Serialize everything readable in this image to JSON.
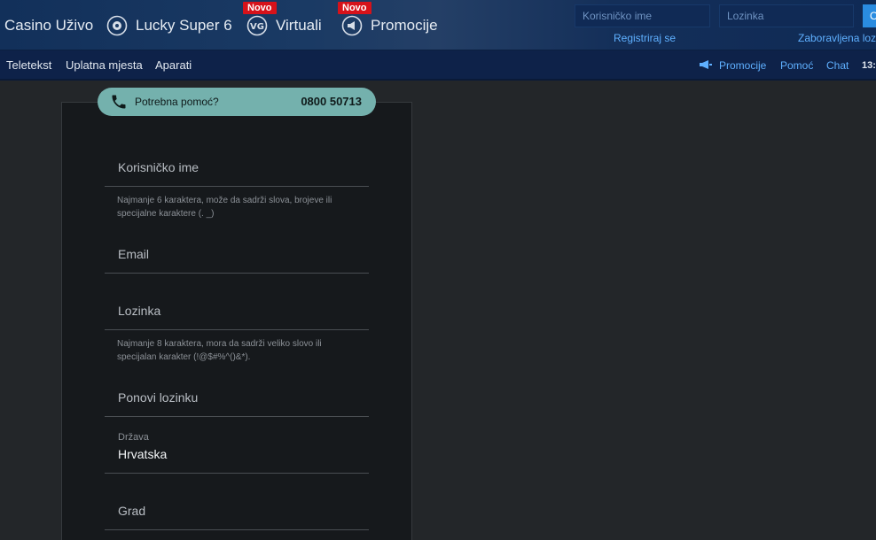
{
  "topnav": {
    "items": [
      {
        "label": "Casino Uživo",
        "icon": ""
      },
      {
        "label": "Lucky Super 6",
        "icon": "gear-cog-icon"
      },
      {
        "label": "Virtuali",
        "icon": "vg-badge-icon",
        "badge": "Novo"
      },
      {
        "label": "Promocije",
        "icon": "megaphone-icon",
        "badge": "Novo"
      }
    ]
  },
  "login": {
    "username_placeholder": "Korisničko ime",
    "password_placeholder": "Lozinka",
    "submit_label": "O",
    "register_link": "Registriraj se",
    "forgot_link": "Zaboravljena lozi"
  },
  "subnav": {
    "left": [
      "Teletekst",
      "Uplatna mjesta",
      "Aparati"
    ],
    "promotions": "Promocije",
    "help": "Pomoć",
    "chat": "Chat",
    "clock": "13:"
  },
  "helpbar": {
    "label": "Potrebna pomoć?",
    "phone": "0800 50713"
  },
  "form": {
    "username": "Korisničko ime",
    "username_hint": "Najmanje 6 karaktera, može da sadrži slova, brojeve ili specijalne karaktere (. _)",
    "email": "Email",
    "password": "Lozinka",
    "password_hint": "Najmanje 8 karaktera, mora da sadrži veliko slovo ili specijalan karakter (!@$#%^()&*).",
    "password_repeat": "Ponovi lozinku",
    "country_label": "Država",
    "country_value": "Hrvatska",
    "city": "Grad"
  },
  "colors": {
    "header_bg": "#12305a",
    "subnav_bg": "#0e2249",
    "link": "#5fb0ff",
    "badge": "#d6121a",
    "helpbar": "#74b1ad",
    "panel_bg": "#16191c"
  }
}
